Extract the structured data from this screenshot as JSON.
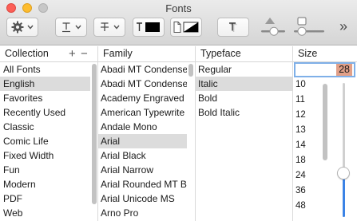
{
  "window": {
    "title": "Fonts"
  },
  "toolbar": {
    "more_label": "»"
  },
  "columns": {
    "collection": {
      "header": "Collection",
      "add": "+",
      "remove": "−"
    },
    "family": {
      "header": "Family"
    },
    "typeface": {
      "header": "Typeface"
    },
    "size": {
      "header": "Size"
    }
  },
  "collections": [
    "All Fonts",
    "English",
    "Favorites",
    "Recently Used",
    "Classic",
    "Comic Life",
    "Fixed Width",
    "Fun",
    "Modern",
    "PDF",
    "Web"
  ],
  "collection_selected": 1,
  "families": [
    "Abadi MT Condense",
    "Abadi MT Condense",
    "Academy Engraved",
    "American Typewrite",
    "Andale Mono",
    "Arial",
    "Arial Black",
    "Arial Narrow",
    "Arial Rounded MT B",
    "Arial Unicode MS",
    "Arno Pro"
  ],
  "family_selected": 5,
  "typefaces": [
    "Regular",
    "Italic",
    "Bold",
    "Bold Italic"
  ],
  "typeface_selected": 1,
  "size": {
    "current": "28",
    "options": [
      "10",
      "11",
      "12",
      "13",
      "14",
      "18",
      "24",
      "36",
      "48"
    ],
    "slider_fraction": 0.33
  },
  "colors": {
    "selection": "#dcdcdc",
    "size_highlight": "#e2a088",
    "focus_ring": "#7fb0e8",
    "slider_fill": "#3b83e6"
  }
}
